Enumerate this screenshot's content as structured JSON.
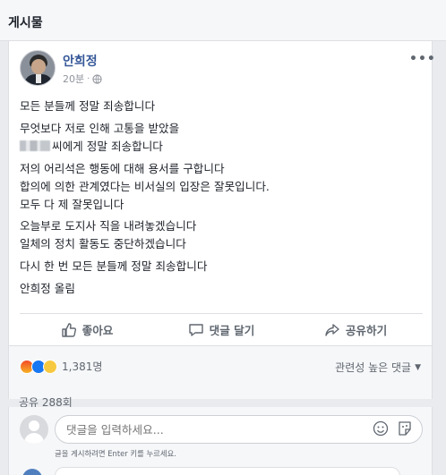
{
  "section": {
    "title": "게시물"
  },
  "post": {
    "author": "안희정",
    "time": "20분",
    "dot": "·",
    "more": "•••",
    "lines": {
      "l1": "모든 분들께 정말 죄송합니다",
      "l2": "무엇보다 저로 인해 고통을 받았을",
      "l3": "씨에게 정말 죄송합니다",
      "l4": "저의 어리석은 행동에 대해 용서를 구합니다",
      "l5": "합의에 의한 관계였다는 비서실의 입장은 잘못입니다.",
      "l6": "모두 다 제 잘못입니다",
      "l7": "오늘부로 도지사 직을 내려놓겠습니다",
      "l8": "일체의 정치 활동도 중단하겠습니다",
      "l9": "다시 한 번 모든 분들께 정말 죄송합니다",
      "l10": "안희정 올림"
    }
  },
  "actions": {
    "like": "좋아요",
    "comment": "댓글 달기",
    "share": "공유하기"
  },
  "reactions": {
    "count": "1,381명",
    "sort_label": "관련성 높은 댓글",
    "caret": "▼"
  },
  "shares": {
    "label": "공유 288회"
  },
  "comment": {
    "placeholder": "댓글을 입력하세요...",
    "hint": "글을 게시하려면 Enter 키를 누르세요."
  },
  "icons": {
    "globe": "globe-icon",
    "like": "thumbs-up-icon",
    "comment": "speech-bubble-icon",
    "share": "share-arrow-icon",
    "emoji": "smiley-icon",
    "sticker": "sticker-icon"
  },
  "colors": {
    "author_link": "#365899",
    "secondary_text": "#606770",
    "border": "#dddfe2",
    "background": "#e9ebee"
  }
}
